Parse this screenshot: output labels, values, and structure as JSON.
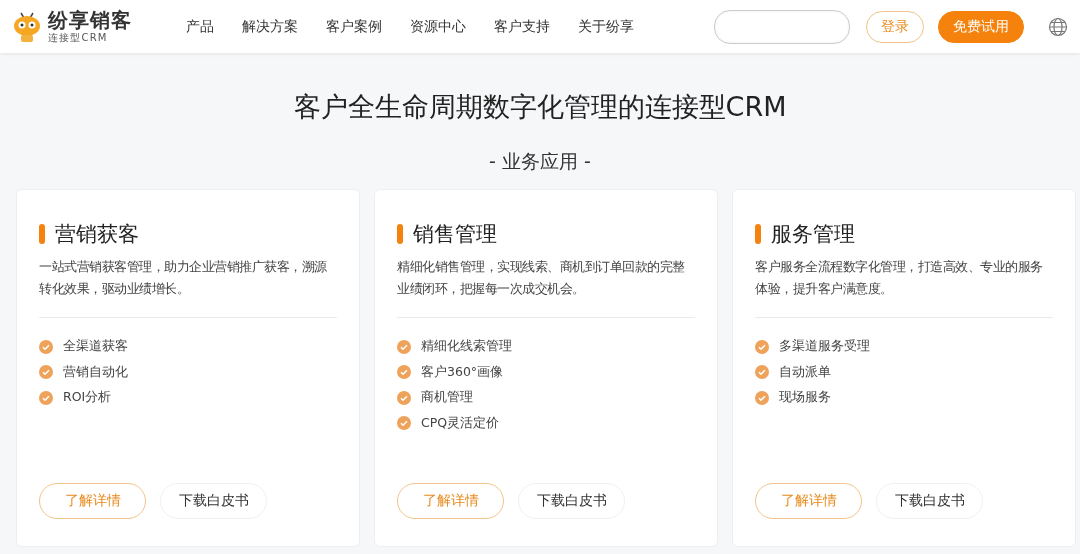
{
  "header": {
    "logo": {
      "name": "纷享销客",
      "tagline": "连 接 型 C R M"
    },
    "nav": [
      "产品",
      "解决方案",
      "客户案例",
      "资源中心",
      "客户支持",
      "关于纷享"
    ],
    "login": "登录",
    "trial": "免费试用"
  },
  "hero": {
    "title": "客户全生命周期数字化管理的连接型CRM",
    "subtitle": "- 业务应用 -"
  },
  "cards": [
    {
      "title": "营销获客",
      "description": "一站式营销获客管理，助力企业营销推广获客，溯源转化效果，驱动业绩增长。",
      "features": [
        "全渠道获客",
        "营销自动化",
        "ROI分析"
      ],
      "details": "了解详情",
      "download": "下载白皮书"
    },
    {
      "title": "销售管理",
      "description": "精细化销售管理，实现线索、商机到订单回款的完整业绩闭环，把握每一次成交机会。",
      "features": [
        "精细化线索管理",
        "客户360°画像",
        "商机管理",
        "CPQ灵活定价"
      ],
      "details": "了解详情",
      "download": "下载白皮书"
    },
    {
      "title": "服务管理",
      "description": "客户服务全流程数字化管理，打造高效、专业的服务体验，提升客户满意度。",
      "features": [
        "多渠道服务受理",
        "自动派单",
        "现场服务"
      ],
      "details": "了解详情",
      "download": "下载白皮书"
    }
  ]
}
